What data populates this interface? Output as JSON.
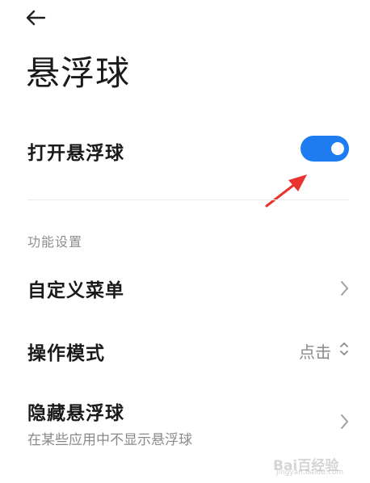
{
  "page": {
    "title": "悬浮球"
  },
  "toggle_row": {
    "label": "打开悬浮球",
    "enabled": true
  },
  "section": {
    "header": "功能设置"
  },
  "items": [
    {
      "label": "自定义菜单"
    },
    {
      "label": "操作模式",
      "value": "点击"
    },
    {
      "label": "隐藏悬浮球",
      "subtitle": "在某些应用中不显示悬浮球"
    }
  ],
  "colors": {
    "accent": "#1e7cf0",
    "annotation": "#e8332f"
  },
  "watermark": {
    "text": "Bai百经验",
    "url": "jingyan.baidu.com"
  }
}
